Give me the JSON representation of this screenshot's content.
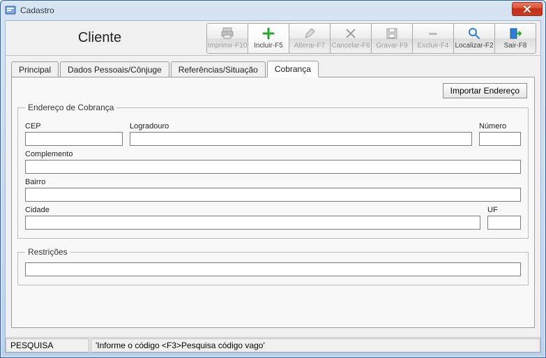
{
  "window": {
    "title": "Cadastro"
  },
  "header": {
    "title": "Cliente"
  },
  "toolbar": {
    "print": "Imprimir-F10",
    "include": "Incluir-F5",
    "alter": "Alterar-F7",
    "cancel": "Cancelar-F6",
    "save": "Gravar-F9",
    "delete": "Excluir-F4",
    "find": "Localizar-F2",
    "exit": "Sair-F8"
  },
  "tabs": {
    "principal": "Principal",
    "dados": "Dados Pessoais/Cônjuge",
    "ref": "Referências/Situação",
    "cobranca": "Cobrança"
  },
  "panel": {
    "importBtn": "Importar Endereço",
    "group1_legend": "Endereço de Cobrança",
    "group2_legend": "Restrições",
    "labels": {
      "cep": "CEP",
      "logradouro": "Logradouro",
      "numero": "Número",
      "complemento": "Complemento",
      "bairro": "Bairro",
      "cidade": "Cidade",
      "uf": "UF"
    },
    "values": {
      "cep": "",
      "logradouro": "",
      "numero": "",
      "complemento": "",
      "bairro": "",
      "cidade": "",
      "uf": "",
      "restricoes": ""
    }
  },
  "status": {
    "left": "PESQUISA",
    "right": "'Informe o código <F3>Pesquisa código vago'"
  },
  "colors": {
    "accent_green": "#27a52f",
    "accent_blue": "#2f7fd0",
    "disabled_grey": "#9e9e9e"
  }
}
